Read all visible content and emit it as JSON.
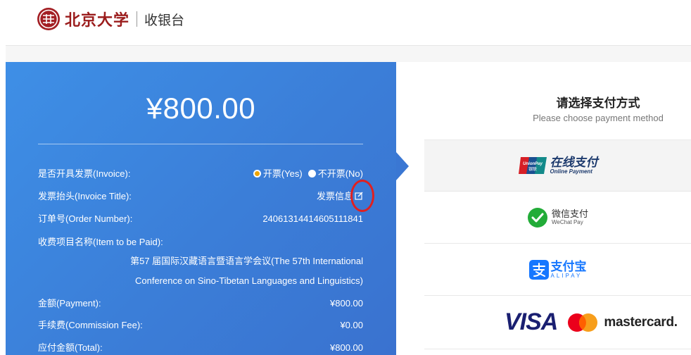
{
  "header": {
    "university_name": "北京大学",
    "page_name": "收银台"
  },
  "order": {
    "amount_display": "¥800.00",
    "invoice": {
      "label": "是否开具发票(Invoice):",
      "option_yes": "开票(Yes)",
      "option_no": "不开票(No)",
      "selected": "yes"
    },
    "invoice_title": {
      "label": "发票抬头(Invoice Title):",
      "value": "发票信息"
    },
    "order_number": {
      "label": "订单号(Order Number):",
      "value": "24061314414605111841"
    },
    "item": {
      "label": "收费项目名称(Item to be Paid):",
      "line1": "第57 届国际汉藏语言暨语言学会议(The 57th International",
      "line2": "Conference on Sino-Tibetan Languages and Linguistics)"
    },
    "payment": {
      "label": "金额(Payment):",
      "value": "¥800.00"
    },
    "commission": {
      "label": "手续费(Commission Fee):",
      "value": "¥0.00"
    },
    "total": {
      "label": "应付金额(Total):",
      "value": "¥800.00"
    }
  },
  "payment_methods": {
    "title": "请选择支付方式",
    "subtitle": "Please choose payment method",
    "unionpay": {
      "cn": "在线支付",
      "en": "Online Payment",
      "badge": "UnionPay",
      "badge_cn": "银联"
    },
    "wechat": {
      "cn": "微信支付",
      "en": "WeChat Pay"
    },
    "alipay": {
      "cn": "支付宝",
      "en": "ALIPAY"
    },
    "card": {
      "visa": "VISA",
      "mastercard": "mastercard."
    }
  },
  "colors": {
    "panel_blue": "#3b7ed8",
    "brand_red": "#9b1c1c",
    "annotation_red": "#e02020",
    "radio_selected": "#f0a500"
  }
}
